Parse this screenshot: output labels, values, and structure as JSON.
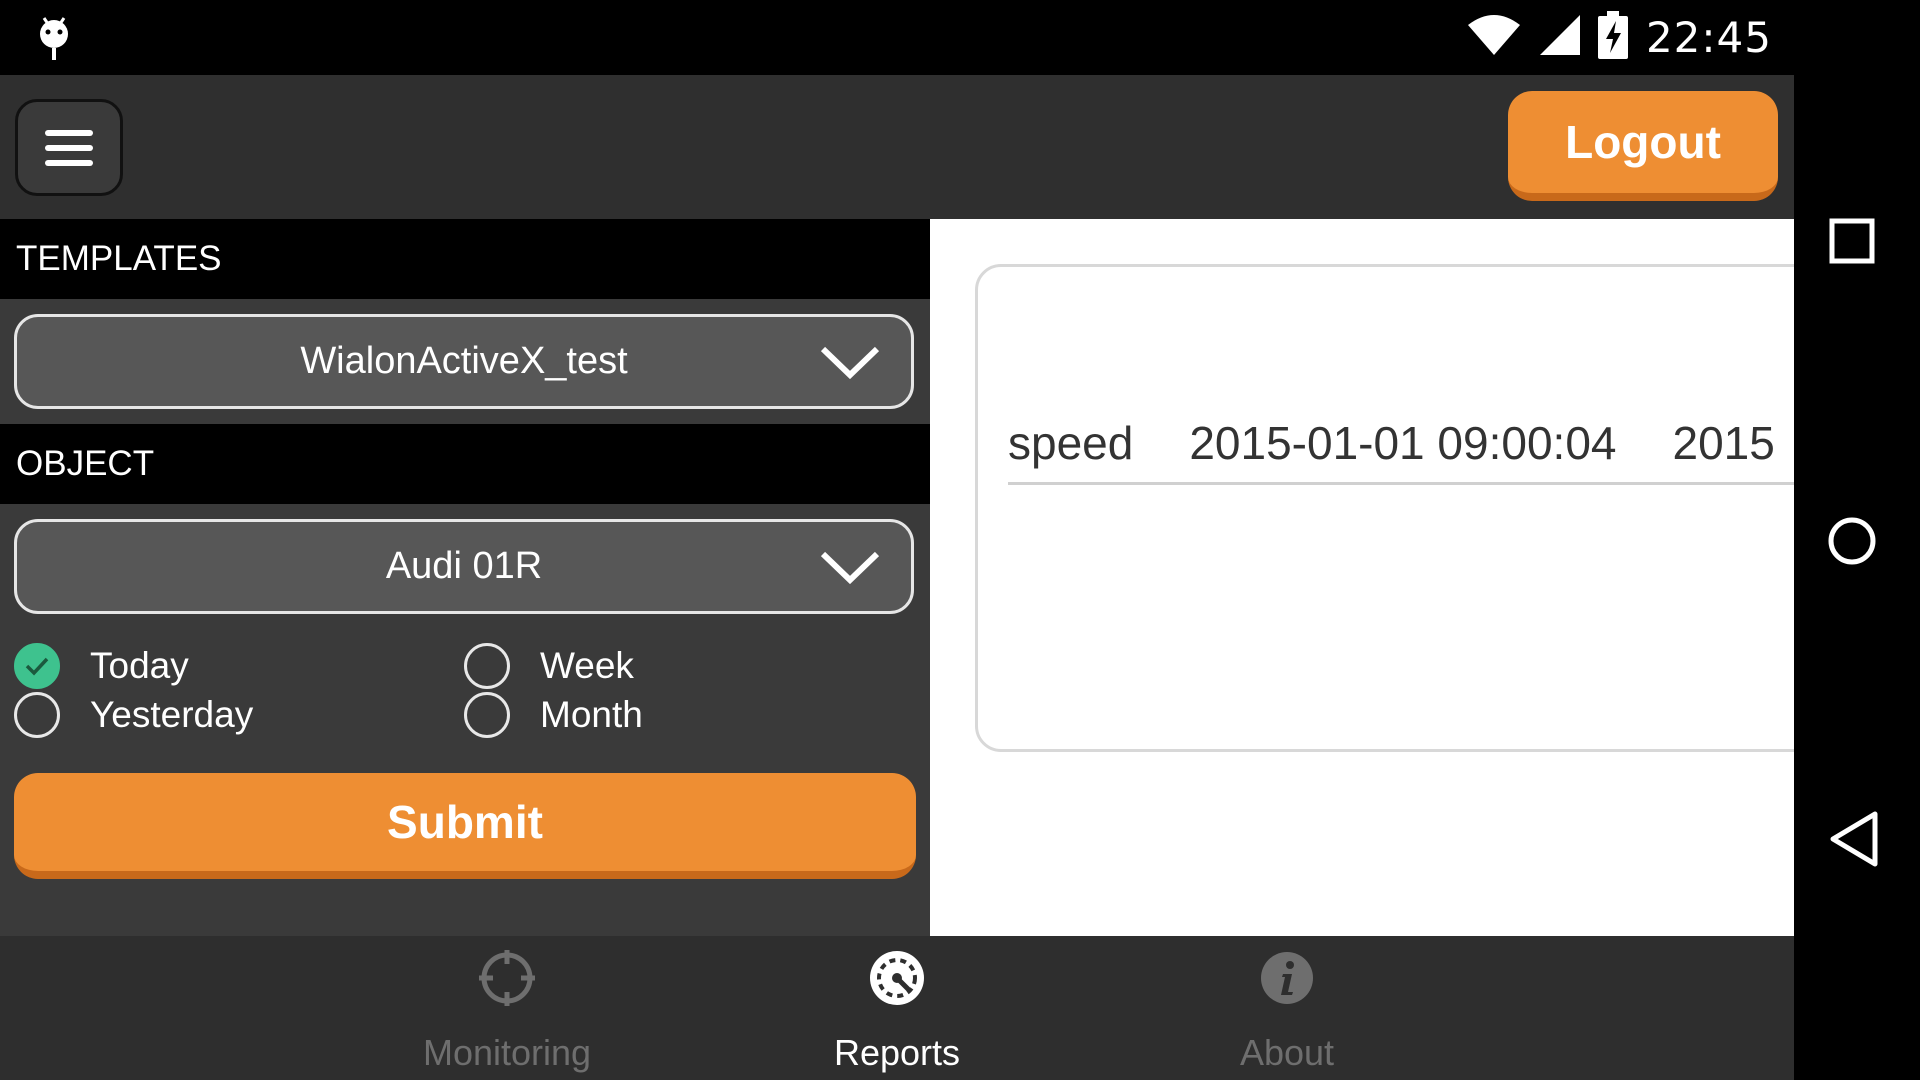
{
  "status_bar": {
    "time": "22:45",
    "icons": [
      "android-debug-icon",
      "wifi-icon",
      "signal-icon",
      "battery-charging-icon"
    ]
  },
  "header": {
    "menu_icon": "hamburger-menu-icon",
    "logout_label": "Logout"
  },
  "form": {
    "templates_heading": "TEMPLATES",
    "template_value": "WialonActiveX_test",
    "object_heading": "OBJECT",
    "object_value": "Audi 01R",
    "periods": [
      {
        "label": "Today",
        "checked": true
      },
      {
        "label": "Week",
        "checked": false
      },
      {
        "label": "Yesterday",
        "checked": false
      },
      {
        "label": "Month",
        "checked": false
      }
    ],
    "submit_label": "Submit"
  },
  "report": {
    "row": [
      "speed",
      "2015-01-01 09:00:04",
      "2015"
    ]
  },
  "bottom_nav": {
    "items": [
      {
        "label": "Monitoring",
        "icon": "crosshair-icon",
        "active": false
      },
      {
        "label": "Reports",
        "icon": "speedometer-icon",
        "active": true
      },
      {
        "label": "About",
        "icon": "info-icon",
        "active": false
      }
    ]
  },
  "system_nav": [
    "recent-apps-icon",
    "home-icon",
    "back-icon"
  ],
  "colors": {
    "accent": "#ee8e33",
    "accent_dark": "#c8691a",
    "check": "#3ec28e",
    "panel": "#3a3a3a",
    "header_bg": "#2f2f2f"
  }
}
